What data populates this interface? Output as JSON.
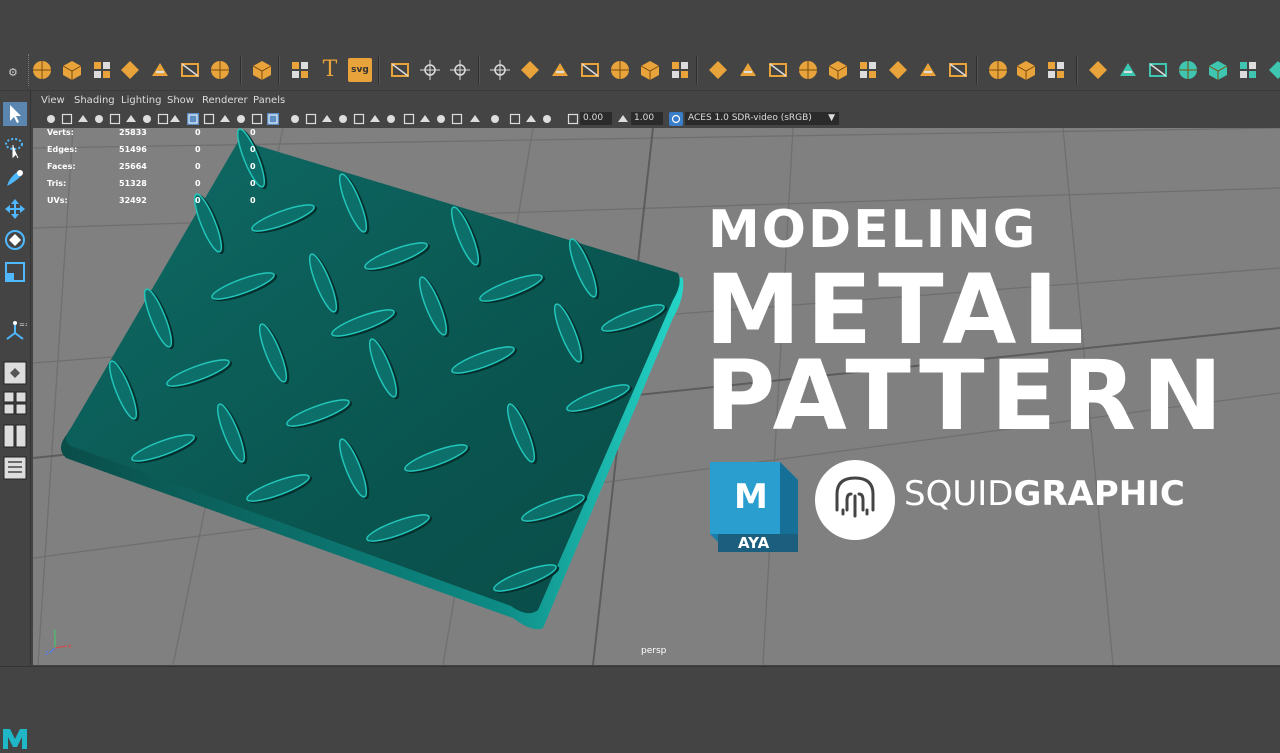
{
  "shelf": {
    "icons": [
      "sphere-icon",
      "cube-icon",
      "cylinder-icon",
      "cone-icon",
      "torus-icon",
      "plane-icon",
      "disk-icon",
      "platonic-icon",
      "sweep-icon",
      "type-icon",
      "svg-icon",
      "center-pivot-icon",
      "tweak-icon",
      "uv-icon",
      "combine-icon",
      "separate-icon",
      "extract-icon",
      "booleans-icon",
      "smooth-icon",
      "mirror-icon",
      "bevel-icon",
      "bridge-icon",
      "extrude-icon",
      "fill-hole-icon",
      "append-icon",
      "split-icon",
      "collapse-icon",
      "merge-icon",
      "target-weld-icon",
      "wedge-icon",
      "crease-icon",
      "multi-cut-icon",
      "quad-draw-icon",
      "sculpt-icon",
      "snap-icon",
      "project-icon",
      "unfold-icon",
      "layout-icon",
      "planar-map-icon",
      "uv-editor-icon",
      "checker-icon"
    ],
    "svg_label": "svg",
    "type_label": "T"
  },
  "panel_menu": [
    "View",
    "Shading",
    "Lighting",
    "Show",
    "Renderer",
    "Panels"
  ],
  "panel_bar": {
    "exposure": "0.00",
    "gamma": "1.00",
    "color_space": "ACES 1.0 SDR-video (sRGB)"
  },
  "hud": {
    "rows": [
      {
        "label": "Verts:",
        "v1": "25833",
        "v2": "0",
        "v3": "0"
      },
      {
        "label": "Edges:",
        "v1": "51496",
        "v2": "0",
        "v3": "0"
      },
      {
        "label": "Faces:",
        "v1": "25664",
        "v2": "0",
        "v3": "0"
      },
      {
        "label": "Tris:",
        "v1": "51328",
        "v2": "0",
        "v3": "0"
      },
      {
        "label": "UVs:",
        "v1": "32492",
        "v2": "0",
        "v3": "0"
      }
    ]
  },
  "overlay": {
    "line1": "MODELING",
    "line2": "METAL",
    "line3": "PATTERN",
    "maya_letter": "M",
    "maya_label": "AYA",
    "brand_light": "SQUID",
    "brand_bold": "GRAPHIC"
  },
  "viewport": {
    "camera": "persp",
    "axis_y": "y",
    "axis_x": "x",
    "axis_z": "z"
  },
  "colors": {
    "icon_orange": "#e8a33a",
    "icon_teal": "#3fc6b0",
    "plate": "#0b5b57",
    "plate_highlight": "#1bbfb3",
    "viewport_bg": "#808080"
  }
}
